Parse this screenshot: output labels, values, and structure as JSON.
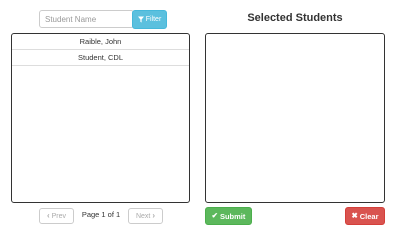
{
  "search": {
    "placeholder": "Student Name",
    "filter_label": "Filter"
  },
  "icons": {
    "filter": "funnel-icon",
    "prev": "chevron-left-icon",
    "next": "chevron-right-icon",
    "submit": "check-icon",
    "clear": "times-icon"
  },
  "students": [
    "Raible, John",
    "Student, CDL"
  ],
  "selected": {
    "title": "Selected Students"
  },
  "pagination": {
    "prev_label": "Prev",
    "page_info": "Page 1 of 1",
    "next_label": "Next"
  },
  "actions": {
    "submit_label": "Submit",
    "clear_label": "Clear"
  },
  "colors": {
    "info": "#5bc0de",
    "success": "#5cb85c",
    "danger": "#d9534f"
  }
}
